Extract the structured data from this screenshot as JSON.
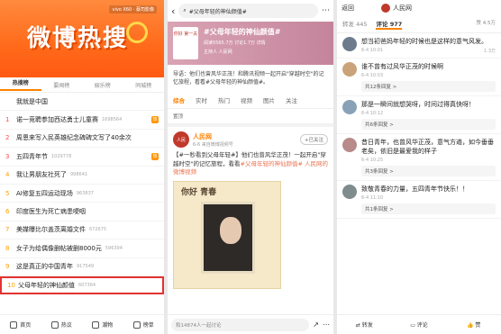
{
  "p1": {
    "banner_title": "微博热搜",
    "ad": "vivo X60 · 蔡司影像",
    "tabs": [
      "热搜榜",
      "要闻榜",
      "娱乐榜",
      "同城榜"
    ],
    "items": [
      {
        "rank": "",
        "title": "我就是中国",
        "num": "",
        "badge": ""
      },
      {
        "rank": "1",
        "title": "诺一竞聘参加西达勇士儿童赛",
        "num": "1698564",
        "badge": "热"
      },
      {
        "rank": "2",
        "title": "周恩来写入民英雄纪念碑碑文写了40余次",
        "num": "",
        "badge": ""
      },
      {
        "rank": "3",
        "title": "五四青年节",
        "num": "1029778",
        "badge": "热"
      },
      {
        "rank": "4",
        "title": "我让男朋友社死了",
        "num": "998641",
        "badge": ""
      },
      {
        "rank": "5",
        "title": "AI修复五四运动现场",
        "num": "963837",
        "badge": ""
      },
      {
        "rank": "6",
        "title": "印度医生为死亡病患哽咽",
        "num": "",
        "badge": ""
      },
      {
        "rank": "7",
        "title": "美媒曝比尔盖茨离婚文件",
        "num": "672675",
        "badge": ""
      },
      {
        "rank": "8",
        "title": "女子为给偶像删帖被删8000元",
        "num": "596394",
        "badge": ""
      },
      {
        "rank": "9",
        "title": "这是真正的中国青年",
        "num": "917549",
        "badge": ""
      },
      {
        "rank": "10",
        "title": "父母年轻的神仙颜值",
        "num": "607364",
        "badge": ""
      }
    ],
    "bottom": [
      "首页",
      "热议",
      "潮物",
      "榜单"
    ]
  },
  "p2": {
    "search": "#父母年轻的神仙颜值#",
    "logo": "你好 第一夫",
    "title": "#父母年轻的神仙颜值#",
    "meta": "阅读5565.7万  讨论1.7万  详情",
    "host": "主持人  人民网",
    "intro": "导语：他们也曾风华正茂！和腾讯视频一起开启\"穿越时空\"的记忆旅程，看看#父母年轻的神仙颜值#。",
    "tabs": [
      "综合",
      "实时",
      "热门",
      "视频",
      "图片",
      "关注"
    ],
    "sort": "置顶",
    "post": {
      "name": "人民网",
      "time": "6-6 来自微博视频号",
      "follow": "+已关注",
      "text_a": "【#一秒看到父母年轻#】他们也曾风华正茂！一起开启\"穿越时空\"的记忆旅程，看看",
      "text_b": "#父母年轻的神仙颜值#",
      "text_c": " 人民网的微博视频",
      "img_label": "你好 青春"
    },
    "comment_ph": "和14874人一起讨论"
  },
  "p3": {
    "back": "返回",
    "account": "人民网",
    "tabs": [
      "转发 445",
      "评论 977",
      "赞 4.5万"
    ],
    "sort": "按热度",
    "comments": [
      {
        "name": "",
        "text": "想当初爸妈年轻的时候也是这样的意气风发。",
        "time": "6-4 10:01",
        "like": "1.3万",
        "reply": ""
      },
      {
        "name": "",
        "text": "谁不曾有过风华正茂的时候啊",
        "time": "6-4 10:03",
        "like": "",
        "reply": "共12条回复 >"
      },
      {
        "name": "",
        "text": "那是一瞬间就想哭呀，时间过得真快呀！",
        "time": "6-4 10:12",
        "like": "",
        "reply": "共6条回复 >"
      },
      {
        "name": "",
        "text": "昔日青年，也曾风华正茂，意气方遒，如今垂垂老矣，依旧是最爱我的样子",
        "time": "6-4 10:25",
        "like": "",
        "reply": "共3条回复 >"
      },
      {
        "name": "",
        "text": "致敬青春的力量，五四青年节快乐！！",
        "time": "6-4 11:10",
        "like": "",
        "reply": "共1条回复 >"
      }
    ],
    "bottom": [
      "转发",
      "评论",
      "赞"
    ]
  }
}
